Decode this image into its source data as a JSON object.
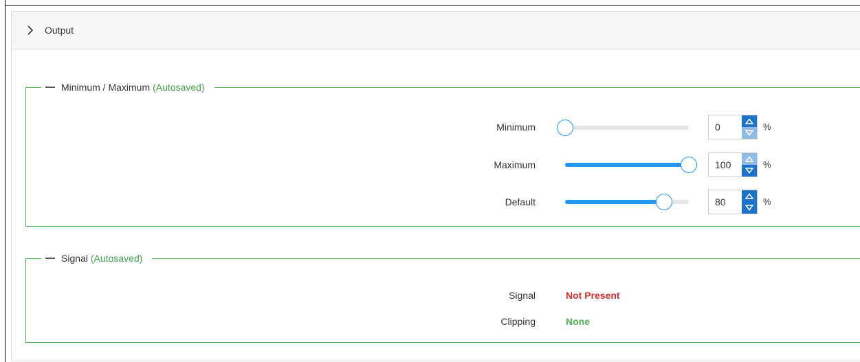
{
  "header": {
    "title": "Output",
    "chevron_icon": "chevron-right-icon"
  },
  "groups": {
    "minmax": {
      "title": "Minimum / Maximum",
      "autosaved": "(Autosaved)",
      "rows": [
        {
          "label": "Minimum",
          "value": "0",
          "unit": "%",
          "slider_fraction": 0.0
        },
        {
          "label": "Maximum",
          "value": "100",
          "unit": "%",
          "slider_fraction": 1.0
        },
        {
          "label": "Default",
          "value": "80",
          "unit": "%",
          "slider_fraction": 0.8
        }
      ]
    },
    "signal": {
      "title": "Signal",
      "autosaved": "(Autosaved)",
      "rows": [
        {
          "label": "Signal",
          "value": "Not Present"
        },
        {
          "label": "Clipping",
          "value": "None"
        }
      ]
    }
  },
  "colors": {
    "accent": "#2196f3",
    "group_border": "#4caf50",
    "autosaved": "#43a047",
    "not_present": "#d32f2f",
    "none": "#4caf50"
  }
}
